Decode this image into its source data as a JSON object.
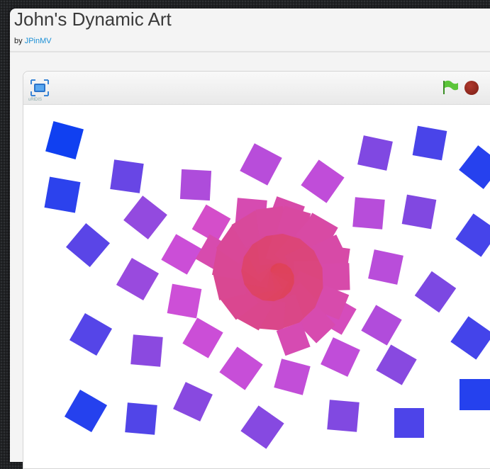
{
  "project": {
    "title": "John's Dynamic Art",
    "by_prefix": "by ",
    "author": "JPinMV"
  },
  "player": {
    "fullscreen_icon": "fullscreen-icon",
    "fullscreen_caption": "uRlDIS",
    "green_flag_icon": "green-flag-icon",
    "stop_icon": "stop-icon",
    "colors": {
      "flag": "#5cc53a",
      "stop": "#8b2a1e",
      "center": "#e0404a",
      "mid": "#d34fd6",
      "outer": "#0a3ff2"
    }
  }
}
